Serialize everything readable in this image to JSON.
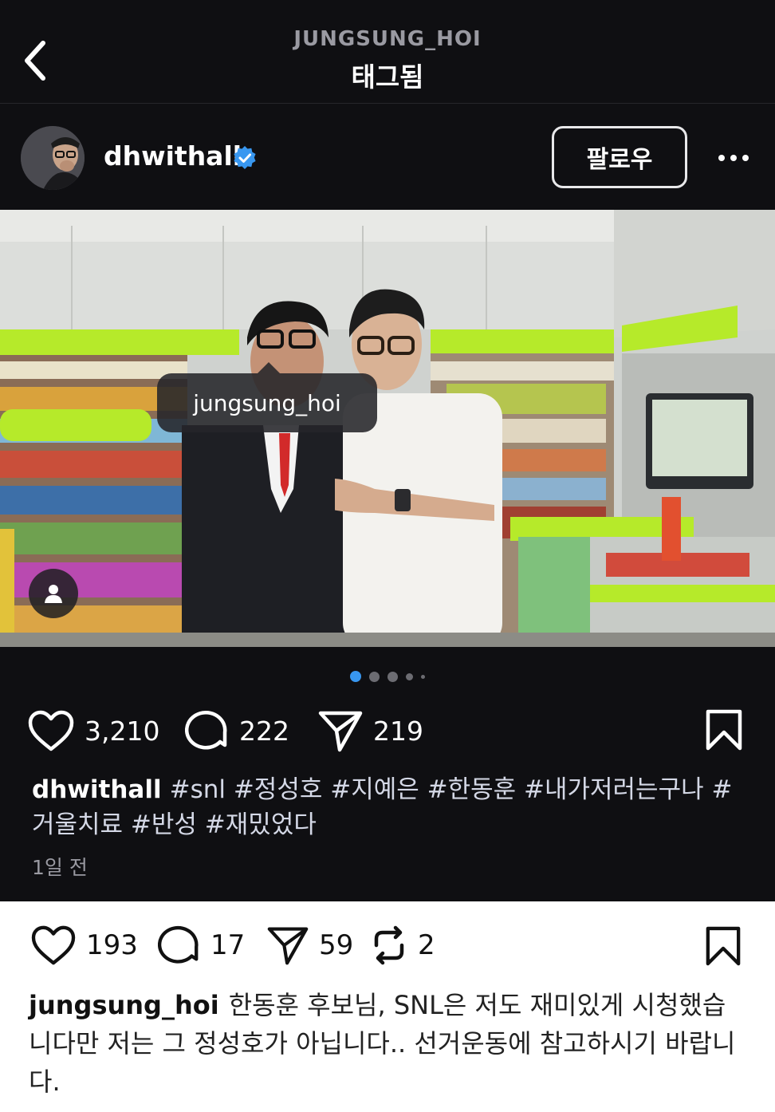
{
  "header": {
    "username": "JUNGSUNG_HOI",
    "title": "태그됨"
  },
  "post": {
    "author": "dhwithall",
    "follow_label": "팔로우",
    "photo_tag": "jungsung_hoi",
    "likes": "3,210",
    "comments": "222",
    "shares": "219",
    "caption_user": "dhwithall",
    "caption_tags": "#snl #정성호 #지예은 #한동훈 #내가저러는구나 #거울치료 #반성 #재밌었다",
    "time": "1일 전",
    "carousel": {
      "count": 5,
      "active": 1
    }
  },
  "reply": {
    "likes": "193",
    "comments": "17",
    "shares": "59",
    "reposts": "2",
    "user": "jungsung_hoi",
    "text": "한동훈 후보님, SNL은 저도 재미있게 시청했습니다만 저는 그 정성호가 아닙니다.. 선거운동에 참고하시기 바랍니다."
  },
  "colors": {
    "accent_blue": "#3897f0",
    "dark_bg": "#0f0f12",
    "store_green": "#b6ea2a"
  }
}
